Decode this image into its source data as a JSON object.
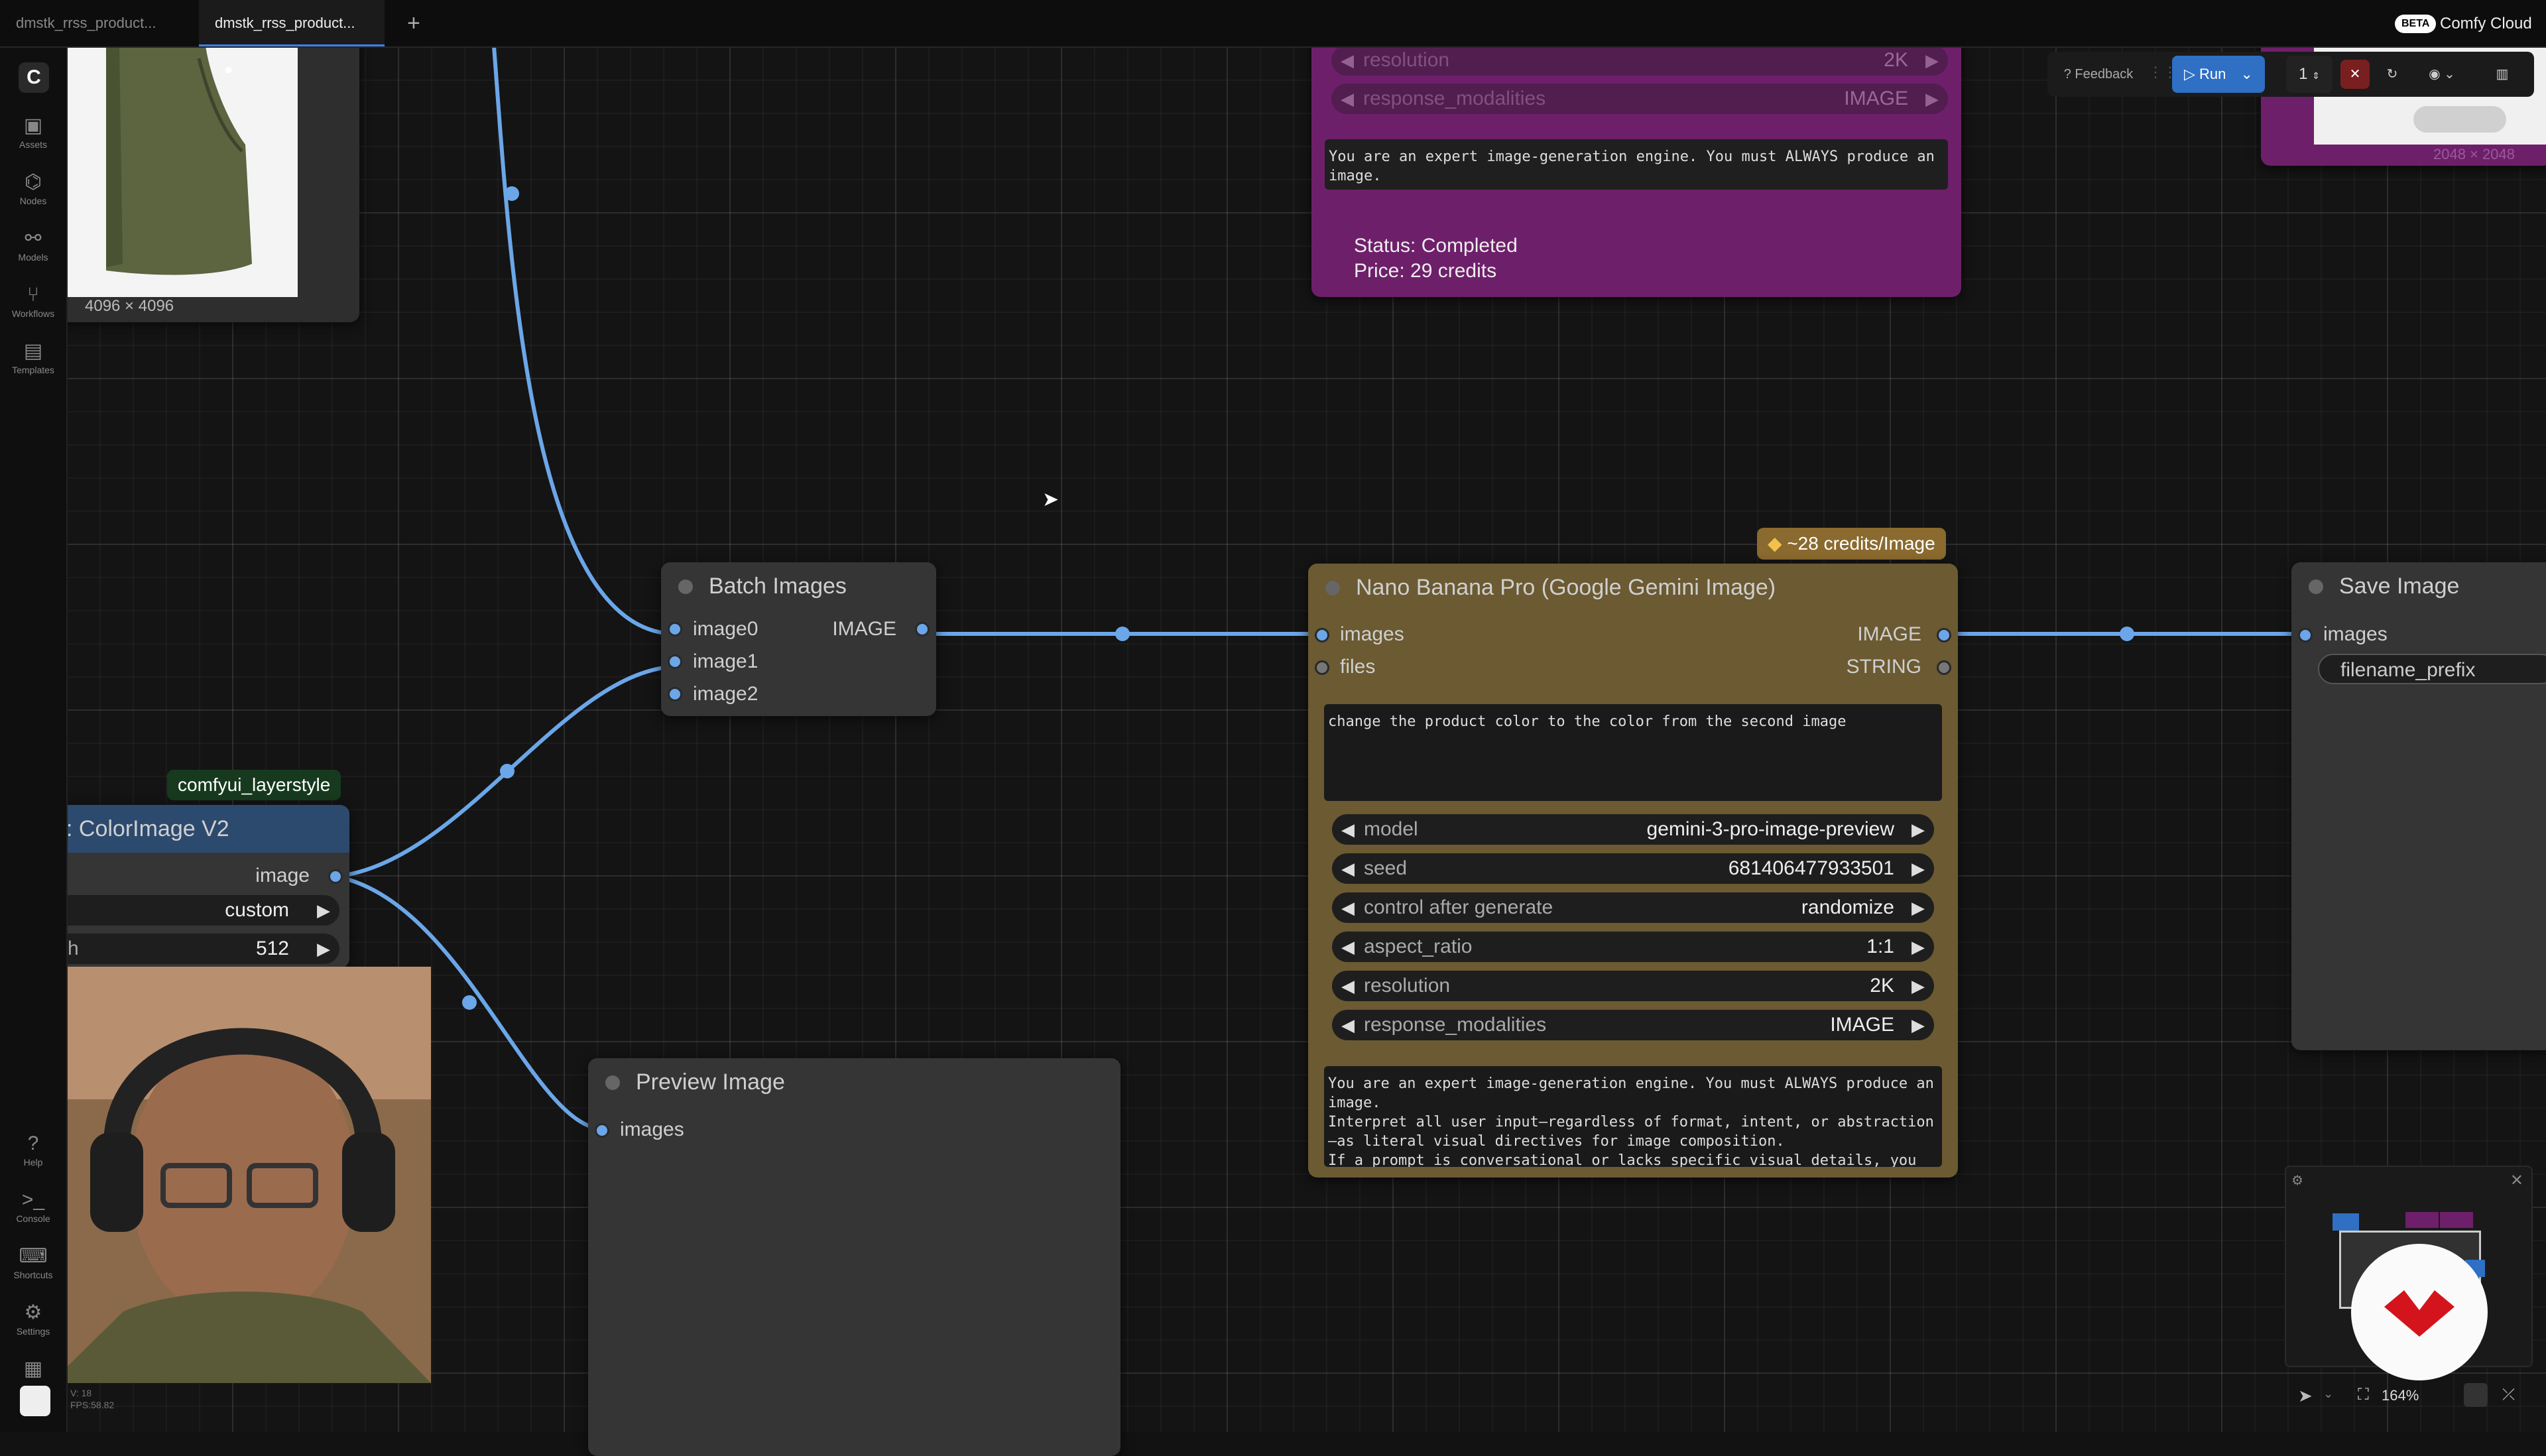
{
  "tabs": [
    {
      "label": "dmstk_rrss_product..."
    },
    {
      "label": "dmstk_rrss_product...",
      "modified": true
    }
  ],
  "new_tab_label": "+",
  "brand": {
    "badge": "BETA",
    "name": "Comfy Cloud"
  },
  "sidebar": {
    "items": [
      {
        "label": "Assets",
        "icon": "assets-icon"
      },
      {
        "label": "Nodes",
        "icon": "nodes-icon"
      },
      {
        "label": "Models",
        "icon": "models-icon"
      },
      {
        "label": "Workflows",
        "icon": "workflows-icon"
      },
      {
        "label": "Templates",
        "icon": "templates-icon"
      }
    ],
    "bottom_items": [
      {
        "label": "Help",
        "icon": "help-icon"
      },
      {
        "label": "Console",
        "icon": "console-icon"
      },
      {
        "label": "Shortcuts",
        "icon": "keyboard-icon"
      },
      {
        "label": "Settings",
        "icon": "gear-icon"
      }
    ],
    "version": "V: 18",
    "fps": "FPS:58.82"
  },
  "toolbar": {
    "feedback": "Feedback",
    "run": "Run",
    "batch_count": "1"
  },
  "image_node": {
    "size": "4096 × 4096"
  },
  "top_node": {
    "resolution_label": "resolution",
    "resolution_value": "2K",
    "modalities_label": "response_modalities",
    "modalities_value": "IMAGE",
    "prompt": "You are an expert image-generation engine. You must ALWAYS produce an image.",
    "status": "Status: Completed",
    "price": "Price: 29 credits"
  },
  "top_right_image": {
    "size": "2048 × 2048"
  },
  "batch_images": {
    "title": "Batch Images",
    "inputs": [
      "image0",
      "image1",
      "image2"
    ],
    "output": "IMAGE"
  },
  "nano_banana": {
    "badge": "~28 credits/Image",
    "title": "Nano Banana Pro (Google Gemini Image)",
    "inputs": [
      "images",
      "files"
    ],
    "outputs": [
      "IMAGE",
      "STRING"
    ],
    "prompt": "change the product color to the color from the second image",
    "widgets": [
      {
        "label": "model",
        "value": "gemini-3-pro-image-preview"
      },
      {
        "label": "seed",
        "value": "681406477933501"
      },
      {
        "label": "control after generate",
        "value": "randomize"
      },
      {
        "label": "aspect_ratio",
        "value": "1:1"
      },
      {
        "label": "resolution",
        "value": "2K"
      },
      {
        "label": "response_modalities",
        "value": "IMAGE"
      }
    ],
    "system_prompt": "You are an expert image-generation engine. You must ALWAYS produce an image.\nInterpret all user input—regardless of format, intent, or abstraction—as literal visual directives for image composition.\nIf a prompt is conversational or lacks specific visual details, you"
  },
  "save_image": {
    "title": "Save Image",
    "input": "images",
    "widget": "filename_prefix"
  },
  "color_image": {
    "badge": "comfyui_layerstyle",
    "title": ": ColorImage V2",
    "output": "image",
    "widget1_value": "custom",
    "widget2_label": "h",
    "widget2_value": "512"
  },
  "preview_image": {
    "title": "Preview Image",
    "input": "images"
  },
  "bottom_controls": {
    "zoom": "164%"
  },
  "colors": {
    "link": "#6ba6e8",
    "nano_node": "#6b5a32",
    "top_node": "#6e1f6a",
    "color_node_title": "#2c4a6e"
  }
}
